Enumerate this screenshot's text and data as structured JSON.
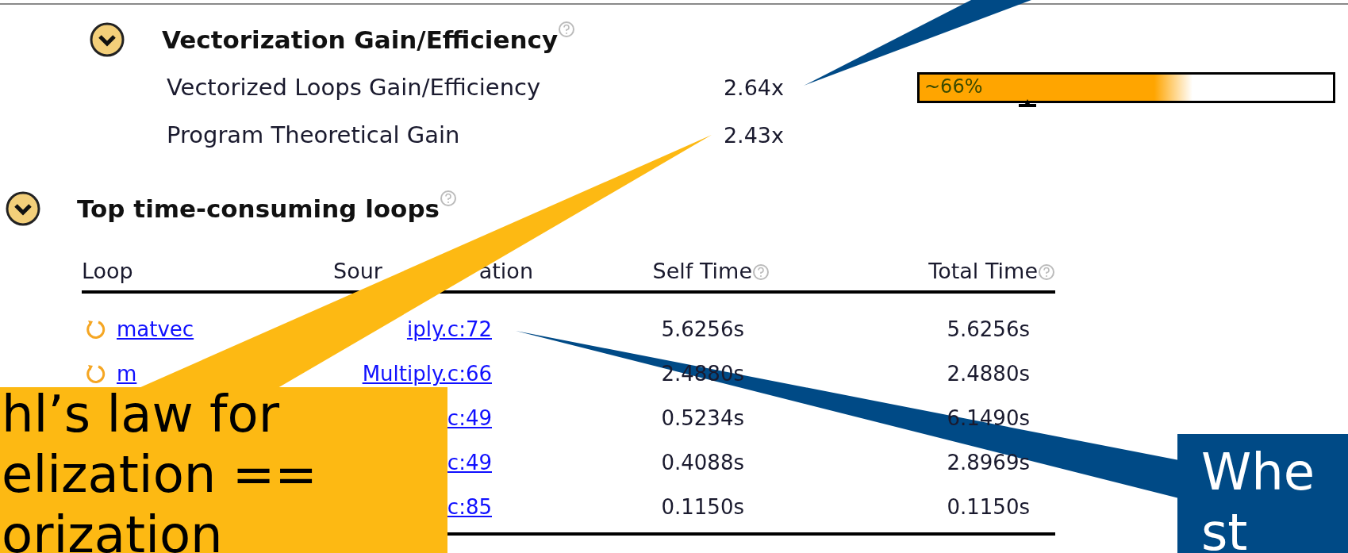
{
  "summary": {
    "title": "Vectorization Gain/Efficiency",
    "expanded": true,
    "metrics": [
      {
        "label": "Vectorized Loops Gain/Efficiency",
        "value": "2.64x",
        "bar": {
          "text": "~66%",
          "level": 0.66
        }
      },
      {
        "label": "Program Theoretical Gain",
        "value": "2.43x"
      }
    ]
  },
  "loops": {
    "title": "Top time-consuming loops",
    "expanded": true,
    "columns": [
      {
        "label": "Loop"
      },
      {
        "label_start": "Sour",
        "label_end": "ation"
      },
      {
        "label": "Self Time"
      },
      {
        "label": "Total Time"
      }
    ],
    "rows": [
      {
        "loop": "matvec",
        "source": "iply.c:72",
        "self_time": "5.6256s",
        "total_time": "5.6256s"
      },
      {
        "loop": "m",
        "source": "Multiply.c:66",
        "self_time": "2.4880s",
        "total_time": "2.4880s"
      },
      {
        "source": "c:49",
        "self_time": "0.5234s",
        "total_time": "6.1490s"
      },
      {
        "source": "c:49",
        "self_time": "0.4088s",
        "total_time": "2.8969s"
      },
      {
        "source": "c:85",
        "self_time": "0.1150s",
        "total_time": "0.1150s"
      }
    ]
  },
  "callouts": [
    {
      "color": "#004a86"
    },
    {
      "color": "#fdb913",
      "lines": [
        "hl’s law for",
        "elization ==",
        "orization"
      ]
    },
    {
      "color": "#004a86",
      "lines": [
        "Whe",
        "st"
      ]
    }
  ]
}
